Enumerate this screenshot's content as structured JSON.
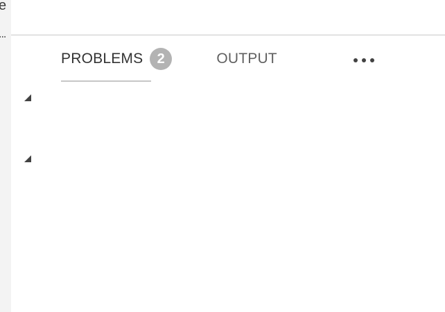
{
  "sidebar": {
    "clipped_title": "e",
    "clipped_more": "..."
  },
  "panel": {
    "tabs": [
      {
        "label": "PROBLEMS",
        "badge": "2",
        "active": true
      },
      {
        "label": "OUTPUT",
        "active": false
      }
    ],
    "more_icon": "ellipsis-icon",
    "tree": [
      {
        "expanded": true,
        "icon": "expanded-twistie-icon"
      },
      {
        "expanded": true,
        "icon": "expanded-twistie-icon"
      }
    ]
  },
  "colors": {
    "badge_bg": "#b3b3b3",
    "active_tab_text": "#333333",
    "inactive_tab_text": "#616161",
    "divider": "#c8c8c8",
    "gutter": "#f3f3f3"
  }
}
